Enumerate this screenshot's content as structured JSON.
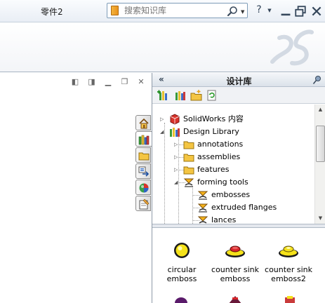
{
  "window": {
    "doc_title": "零件2",
    "search_placeholder": "搜索知识库",
    "help_label": "?",
    "search_icon": "magnifier-icon",
    "help_icon": "help-icon",
    "minimize_icon": "minimize-icon",
    "restore_icon": "restore-icon",
    "close_icon": "close-icon"
  },
  "panel": {
    "title": "设计库",
    "collapse_label": "«",
    "tools": [
      "add-to-library-icon",
      "add-location-icon",
      "new-folder-icon",
      "refresh-icon"
    ],
    "tree": [
      {
        "label": "SolidWorks 内容",
        "icon": "solidworks-content-icon",
        "level": 0,
        "expander": "+"
      },
      {
        "label": "Design Library",
        "icon": "design-library-icon",
        "level": 0,
        "expander": "-"
      },
      {
        "label": "annotations",
        "icon": "folder-icon",
        "level": 1,
        "expander": "+"
      },
      {
        "label": "assemblies",
        "icon": "folder-icon",
        "level": 1,
        "expander": "+"
      },
      {
        "label": "features",
        "icon": "folder-icon",
        "level": 1,
        "expander": "+"
      },
      {
        "label": "forming tools",
        "icon": "forming-tool-icon",
        "level": 1,
        "expander": "-"
      },
      {
        "label": "embosses",
        "icon": "forming-tool-icon",
        "level": 2,
        "expander": ""
      },
      {
        "label": "extruded flanges",
        "icon": "forming-tool-icon",
        "level": 2,
        "expander": ""
      },
      {
        "label": "lances",
        "icon": "forming-tool-icon",
        "level": 2,
        "expander": ""
      }
    ],
    "gallery": [
      {
        "label": "circular emboss",
        "icon": "circular-emboss-icon"
      },
      {
        "label": "counter sink emboss",
        "icon": "counter-sink-emboss-icon"
      },
      {
        "label": "counter sink emboss2",
        "icon": "counter-sink-emboss2-icon"
      }
    ]
  },
  "side_tabs": [
    "home-icon",
    "design-library-icon",
    "file-explorer-icon",
    "view-palette-icon",
    "appearances-icon",
    "custom-properties-icon"
  ],
  "colors": {
    "accent": "#316ac5",
    "folder": "#f4c542",
    "emboss_yellow": "#f5e21a",
    "emboss_red": "#d8262a"
  }
}
